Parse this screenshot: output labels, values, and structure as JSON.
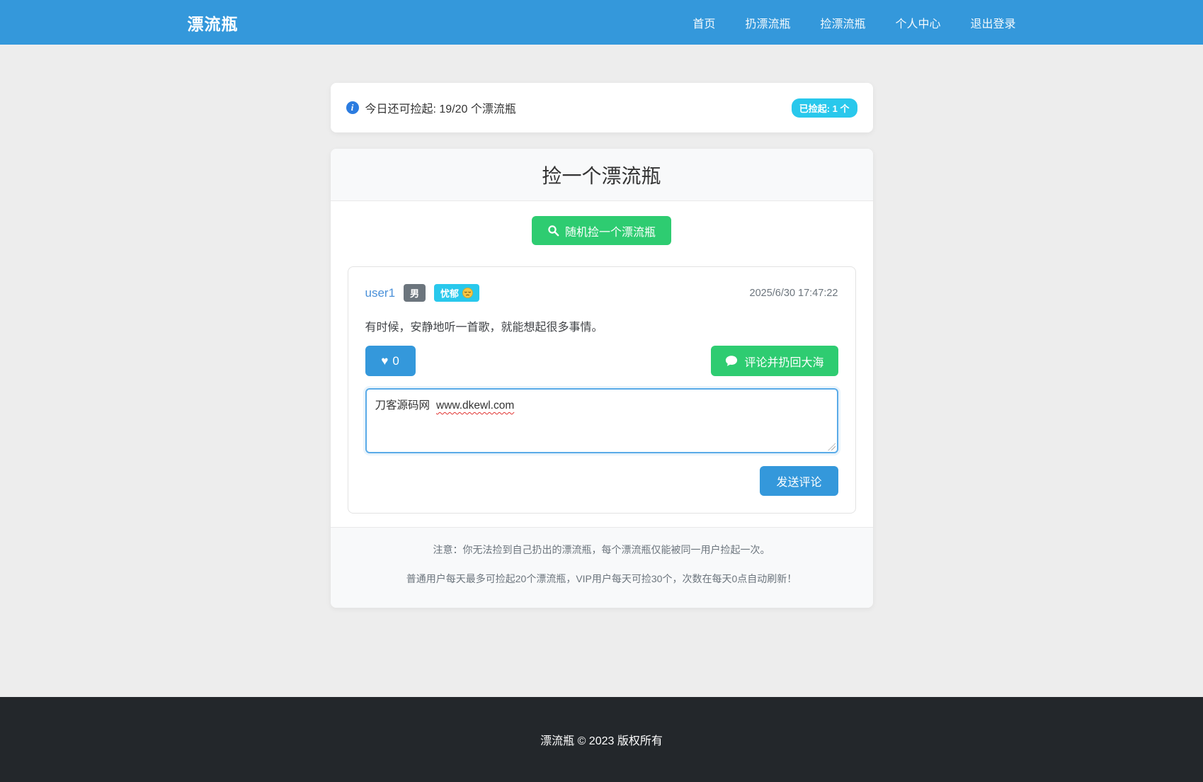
{
  "navbar": {
    "brand": "漂流瓶",
    "items": [
      "首页",
      "扔漂流瓶",
      "捡漂流瓶",
      "个人中心",
      "退出登录"
    ]
  },
  "quota": {
    "info_text": "今日还可捡起: 19/20 个漂流瓶",
    "picked_badge": "已捡起: 1 个"
  },
  "main": {
    "title": "捡一个漂流瓶",
    "random_button": "随机捡一个漂流瓶",
    "bottle": {
      "username": "user1",
      "gender": "男",
      "mood_label": "忧郁",
      "mood_emoji": "😔",
      "time": "2025/6/30 17:47:22",
      "content": "有时候，安静地听一首歌，就能想起很多事情。",
      "like_count": "0",
      "comment_button": "评论并扔回大海",
      "comment_draft": {
        "text": "刀客源码网",
        "url": "www.dkewl.com"
      },
      "send_button": "发送评论"
    },
    "notes": [
      "注意：你无法捡到自己扔出的漂流瓶，每个漂流瓶仅能被同一用户捡起一次。",
      "普通用户每天最多可捡起20个漂流瓶，VIP用户每天可捡30个，次数在每天0点自动刷新！"
    ]
  },
  "footer": {
    "copyright": "漂流瓶 © 2023 版权所有"
  },
  "colors": {
    "navbar_blue": "#3498db",
    "button_green": "#2ecc71",
    "button_blue": "#3498db",
    "badge_cyan": "#29c8ec",
    "badge_gray": "#6c757d",
    "footer_bg": "#23272b",
    "page_bg": "#ededed"
  }
}
